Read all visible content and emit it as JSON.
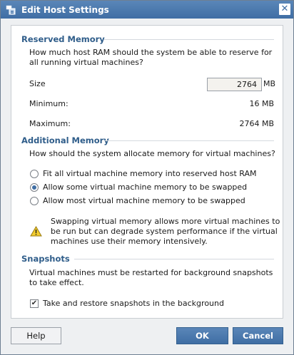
{
  "window": {
    "title": "Edit Host Settings",
    "close_glyph": "✕",
    "icon": "host-settings-icon"
  },
  "reserved_memory": {
    "title": "Reserved Memory",
    "description_line1": "How much host RAM should the system be able to reserve for",
    "description_line2": "all running virtual machines?",
    "size_label": "Size",
    "size_value": "2764",
    "size_unit": "MB",
    "minimum_label": "Minimum:",
    "minimum_value": "16 MB",
    "maximum_label": "Maximum:",
    "maximum_value": "2764 MB"
  },
  "additional_memory": {
    "title": "Additional Memory",
    "description": "How should the system allocate memory for virtual machines?",
    "options": [
      {
        "label": "Fit all virtual machine memory into reserved host RAM",
        "checked": false
      },
      {
        "label": "Allow some virtual machine memory to be swapped",
        "checked": true
      },
      {
        "label": "Allow most virtual machine memory to be swapped",
        "checked": false
      }
    ],
    "warning_line1": "Swapping virtual memory allows more virtual machines to",
    "warning_line2": "be run but can degrade system performance if the virtual",
    "warning_line3": "machines use their memory intensively.",
    "warning_icon": "warning-icon"
  },
  "snapshots": {
    "title": "Snapshots",
    "description_line1": "Virtual machines must be restarted for background snapshots",
    "description_line2": "to take effect.",
    "checkbox_label": "Take and restore snapshots in the background",
    "checkbox_checked": true,
    "check_glyph": "✔"
  },
  "buttons": {
    "help": "Help",
    "ok": "OK",
    "cancel": "Cancel"
  },
  "colors": {
    "accent": "#3f6ea4",
    "section_title": "#2f5d8a"
  }
}
